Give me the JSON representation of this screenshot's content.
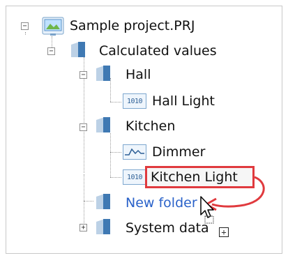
{
  "tree": {
    "root": {
      "label": "Sample project.PRJ",
      "icon": "project-icon",
      "state": "expanded"
    },
    "calculated": {
      "label": "Calculated values",
      "icon": "folder-icon",
      "state": "expanded"
    },
    "hall": {
      "label": "Hall",
      "icon": "folder-icon",
      "state": "expanded"
    },
    "hall_light": {
      "label": "Hall Light",
      "icon": "binary-value-icon"
    },
    "kitchen": {
      "label": "Kitchen",
      "icon": "folder-icon",
      "state": "expanded"
    },
    "dimmer": {
      "label": "Dimmer",
      "icon": "analog-value-icon"
    },
    "kitchen_light": {
      "label": "Kitchen Light",
      "icon": "binary-value-icon",
      "highlighted": true
    },
    "new_folder": {
      "label": "New folder",
      "icon": "folder-icon"
    },
    "system_data": {
      "label": "System data",
      "icon": "folder-icon",
      "state": "collapsed"
    }
  },
  "icon_text": {
    "binary": "1010"
  },
  "expander_glyphs": {
    "expanded": "−",
    "collapsed": "+",
    "drag_add": "+"
  },
  "colors": {
    "highlight": "#e03a3e",
    "link": "#2a62c9"
  }
}
